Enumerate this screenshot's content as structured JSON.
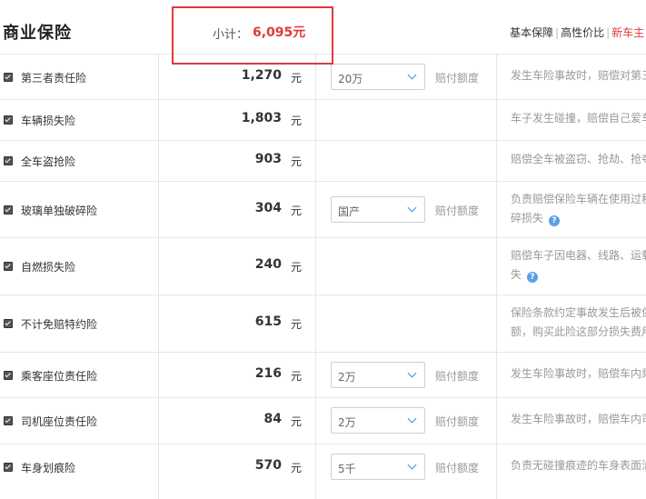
{
  "header": {
    "title": "商业保险",
    "subtotal_label": "小计：",
    "subtotal_value": "6,095元",
    "links": [
      "基本保障",
      "高性价比",
      "新车主"
    ]
  },
  "unit": "元",
  "rows": [
    {
      "name": "第三者责任险",
      "amount": "1,270",
      "select": "20万",
      "select_label": "赔付额度",
      "desc": [
        "发生车险事故时，赔偿对第三"
      ]
    },
    {
      "name": "车辆损失险",
      "amount": "1,803",
      "desc": [
        "车子发生碰撞，赔偿自己爱车"
      ]
    },
    {
      "name": "全车盗抢险",
      "amount": "903",
      "desc": [
        "赔偿全车被盗窃、抢劫、抢夺"
      ]
    },
    {
      "name": "玻璃单独破碎险",
      "amount": "304",
      "select": "国产",
      "select_label": "赔付额度",
      "desc": [
        "负责赔偿保险车辆在使用过程",
        "碎损失"
      ]
    },
    {
      "name": "自燃损失险",
      "amount": "240",
      "desc": [
        "赔偿车子因电器、线路、运载",
        "失"
      ]
    },
    {
      "name": "不计免赔特约险",
      "amount": "615",
      "desc": [
        "保险条款约定事故发生后被保",
        "额，购买此险这部分损失费用"
      ]
    },
    {
      "name": "乘客座位责任险",
      "amount": "216",
      "select": "2万",
      "select_label": "赔付额度",
      "desc": [
        "发生车险事故时，赔偿车内乘"
      ]
    },
    {
      "name": "司机座位责任险",
      "amount": "84",
      "select": "2万",
      "select_label": "赔付额度",
      "desc": [
        "发生车险事故时，赔偿车内司"
      ]
    },
    {
      "name": "车身划痕险",
      "amount": "570",
      "select": "5千",
      "select_label": "赔付额度",
      "desc": [
        "负责无碰撞痕迹的车身表面油"
      ]
    }
  ]
}
